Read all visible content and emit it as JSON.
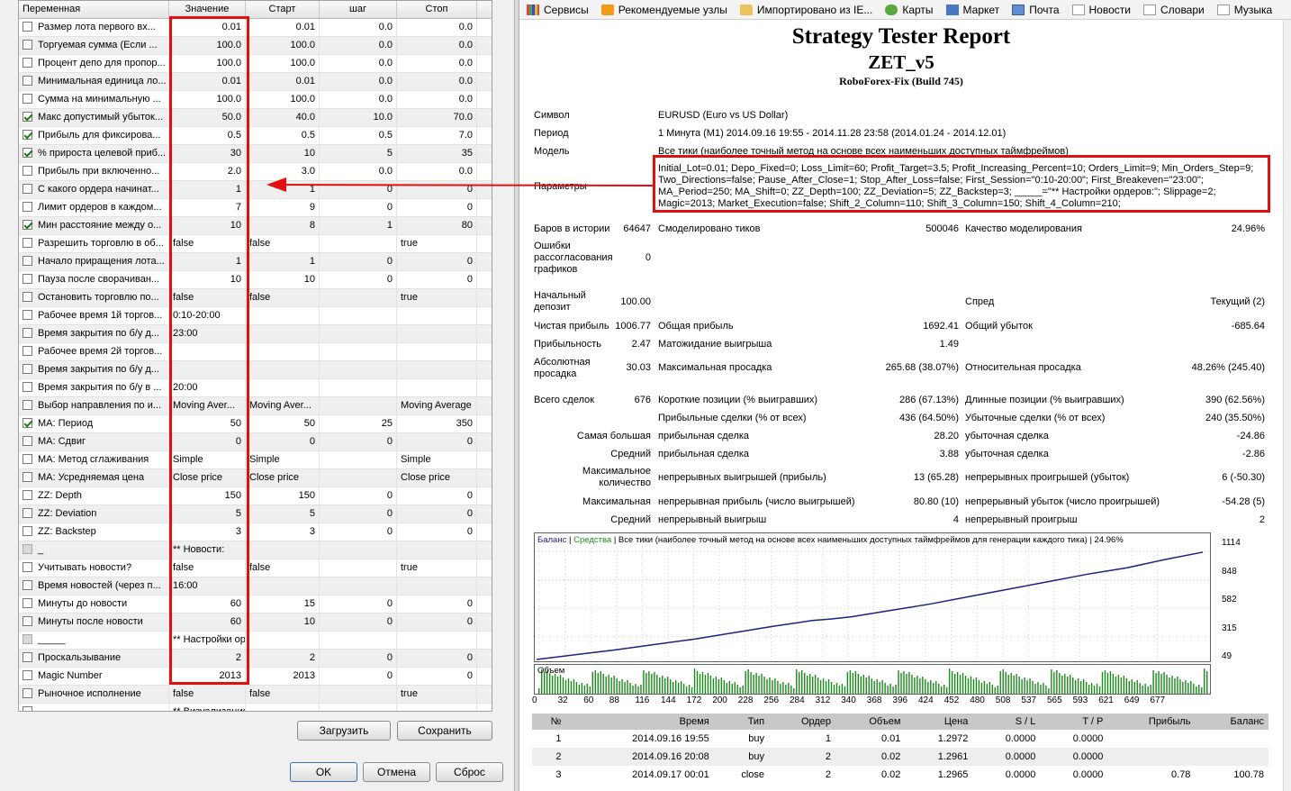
{
  "grid": {
    "headers": [
      "Переменная",
      "Значение",
      "Старт",
      "шаг",
      "Стоп"
    ],
    "rows": [
      {
        "checked": false,
        "name": "Размер лота первого вх...",
        "value": "0.01",
        "start": "0.01",
        "step": "0.0",
        "stop": "0.0",
        "type": "num"
      },
      {
        "checked": false,
        "name": "Торгуемая сумма (Если ...",
        "value": "100.0",
        "start": "100.0",
        "step": "0.0",
        "stop": "0.0",
        "type": "num"
      },
      {
        "checked": false,
        "name": "Процент депо для пропор...",
        "value": "100.0",
        "start": "100.0",
        "step": "0.0",
        "stop": "0.0",
        "type": "num"
      },
      {
        "checked": false,
        "name": "Минимальная единица ло...",
        "value": "0.01",
        "start": "0.01",
        "step": "0.0",
        "stop": "0.0",
        "type": "num"
      },
      {
        "checked": false,
        "name": "Сумма на минимальную ...",
        "value": "100.0",
        "start": "100.0",
        "step": "0.0",
        "stop": "0.0",
        "type": "num"
      },
      {
        "checked": true,
        "name": "Макс допустимый убыток...",
        "value": "50.0",
        "start": "40.0",
        "step": "10.0",
        "stop": "70.0",
        "type": "num"
      },
      {
        "checked": true,
        "name": "Прибыль для фиксирова...",
        "value": "0.5",
        "start": "0.5",
        "step": "0.5",
        "stop": "7.0",
        "type": "num"
      },
      {
        "checked": true,
        "name": "% прироста целевой приб...",
        "value": "30",
        "start": "10",
        "step": "5",
        "stop": "35",
        "type": "num"
      },
      {
        "checked": false,
        "name": "Прибыль при включенно...",
        "value": "2.0",
        "start": "3.0",
        "step": "0.0",
        "stop": "0.0",
        "type": "num"
      },
      {
        "checked": false,
        "name": "С какого ордера начинат...",
        "value": "1",
        "start": "1",
        "step": "0",
        "stop": "0",
        "type": "num"
      },
      {
        "checked": false,
        "name": "Лимит ордеров в каждом...",
        "value": "7",
        "start": "9",
        "step": "0",
        "stop": "0",
        "type": "num"
      },
      {
        "checked": true,
        "name": "Мин расстояние между о...",
        "value": "10",
        "start": "8",
        "step": "1",
        "stop": "80",
        "type": "num"
      },
      {
        "checked": false,
        "name": "Разрешить торговлю в об...",
        "value": "false",
        "start": "false",
        "step": "",
        "stop": "true",
        "type": "txt"
      },
      {
        "checked": false,
        "name": "Начало приращения лота...",
        "value": "1",
        "start": "1",
        "step": "0",
        "stop": "0",
        "type": "num"
      },
      {
        "checked": false,
        "name": "Пауза после сворачиван...",
        "value": "10",
        "start": "10",
        "step": "0",
        "stop": "0",
        "type": "num"
      },
      {
        "checked": false,
        "name": "Остановить торговлю по...",
        "value": "false",
        "start": "false",
        "step": "",
        "stop": "true",
        "type": "txt"
      },
      {
        "checked": false,
        "name": "Рабочее время 1й торгов...",
        "value": "0:10-20:00",
        "start": "",
        "step": "",
        "stop": "",
        "type": "txt"
      },
      {
        "checked": false,
        "name": "Время закрытия по б/у д...",
        "value": "23:00",
        "start": "",
        "step": "",
        "stop": "",
        "type": "txt"
      },
      {
        "checked": false,
        "name": "Рабочее время 2й торгов...",
        "value": "",
        "start": "",
        "step": "",
        "stop": "",
        "type": "txt"
      },
      {
        "checked": false,
        "name": "Время закрытия по б/у д...",
        "value": "",
        "start": "",
        "step": "",
        "stop": "",
        "type": "txt"
      },
      {
        "checked": false,
        "name": "Время закрытия по б/у в ...",
        "value": "20:00",
        "start": "",
        "step": "",
        "stop": "",
        "type": "txt"
      },
      {
        "checked": false,
        "name": "Выбор направления по и...",
        "value": "Moving Aver...",
        "start": "Moving Aver...",
        "step": "",
        "stop": "Moving Average",
        "type": "txt"
      },
      {
        "checked": true,
        "name": "MA: Период",
        "value": "50",
        "start": "50",
        "step": "25",
        "stop": "350",
        "type": "num"
      },
      {
        "checked": false,
        "name": "MA: Сдвиг",
        "value": "0",
        "start": "0",
        "step": "0",
        "stop": "0",
        "type": "num"
      },
      {
        "checked": false,
        "name": "MA: Метод сглаживания",
        "value": "Simple",
        "start": "Simple",
        "step": "",
        "stop": "Simple",
        "type": "txt"
      },
      {
        "checked": false,
        "name": "MA: Усредняемая цена",
        "value": "Close price",
        "start": "Close price",
        "step": "",
        "stop": "Close price",
        "type": "txt"
      },
      {
        "checked": false,
        "name": "ZZ: Depth",
        "value": "150",
        "start": "150",
        "step": "0",
        "stop": "0",
        "type": "num"
      },
      {
        "checked": false,
        "name": "ZZ: Deviation",
        "value": "5",
        "start": "5",
        "step": "0",
        "stop": "0",
        "type": "num"
      },
      {
        "checked": false,
        "name": "ZZ: Backstep",
        "value": "3",
        "start": "3",
        "step": "0",
        "stop": "0",
        "type": "num"
      },
      {
        "checked": false,
        "disabled": true,
        "name": "_",
        "value": "** Новости:",
        "start": "",
        "step": "",
        "stop": "",
        "type": "txt"
      },
      {
        "checked": false,
        "name": "Учитывать новости?",
        "value": "false",
        "start": "false",
        "step": "",
        "stop": "true",
        "type": "txt"
      },
      {
        "checked": false,
        "name": "Время новостей (через п...",
        "value": "16:00",
        "start": "",
        "step": "",
        "stop": "",
        "type": "txt"
      },
      {
        "checked": false,
        "name": "Минуты до новости",
        "value": "60",
        "start": "15",
        "step": "0",
        "stop": "0",
        "type": "num"
      },
      {
        "checked": false,
        "name": "Минуты после новости",
        "value": "60",
        "start": "10",
        "step": "0",
        "stop": "0",
        "type": "num"
      },
      {
        "checked": false,
        "disabled": true,
        "name": "_____",
        "value": "** Настройки ордеров:",
        "start": "",
        "step": "",
        "stop": "",
        "type": "txt"
      },
      {
        "checked": false,
        "name": "Проскальзывание",
        "value": "2",
        "start": "2",
        "step": "0",
        "stop": "0",
        "type": "num"
      },
      {
        "checked": false,
        "name": "Magic Number",
        "value": "2013",
        "start": "2013",
        "step": "0",
        "stop": "0",
        "type": "num"
      },
      {
        "checked": false,
        "name": "Рыночное исполнение",
        "value": "false",
        "start": "false",
        "step": "",
        "stop": "true",
        "type": "txt"
      },
      {
        "checked": false,
        "name": "",
        "value": "** Визуализация:",
        "start": "",
        "step": "",
        "stop": "",
        "type": "txt"
      }
    ]
  },
  "buttons": {
    "load": "Загрузить",
    "save": "Сохранить",
    "ok": "OK",
    "cancel": "Отмена",
    "reset": "Сброс"
  },
  "bookmarks": [
    {
      "label": "Сервисы",
      "icon": "apps-grid-icon",
      "cls": "ico-grid"
    },
    {
      "label": "Рекомендуемые узлы",
      "icon": "recommended-sites-icon",
      "cls": "ico-orange"
    },
    {
      "label": "Импортировано из IE...",
      "icon": "folder-icon",
      "cls": "ico-folder"
    },
    {
      "label": "Карты",
      "icon": "maps-icon",
      "cls": "ico-green"
    },
    {
      "label": "Маркет",
      "icon": "market-icon",
      "cls": "ico-blue"
    },
    {
      "label": "Почта",
      "icon": "mail-icon",
      "cls": "ico-mail"
    },
    {
      "label": "Новости",
      "icon": "page-icon",
      "cls": "ico-doc"
    },
    {
      "label": "Словари",
      "icon": "page-icon",
      "cls": "ico-doc"
    },
    {
      "label": "Музыка",
      "icon": "page-icon",
      "cls": "ico-doc"
    }
  ],
  "report": {
    "title": "Strategy Tester Report",
    "ea": "ZET_v5",
    "server": "RoboForex-Fix (Build 745)",
    "symbol_label": "Символ",
    "symbol": "EURUSD (Euro vs US Dollar)",
    "period_label": "Период",
    "period": "1 Минута (M1) 2014.09.16 19:55 - 2014.11.28 23:58 (2014.01.24 - 2014.12.01)",
    "model_label": "Модель",
    "model": "Все тики (наиболее точный метод на основе всех наименьших доступных таймфреймов)",
    "params_label": "Параметры",
    "params_l1": "Initial_Lot=0.01; Depo_Fixed=0; Loss_Limit=60; Profit_Target=3.5; Profit_Increasing_Percent=10; Orders_Limit=9; Min_Orders_Step=9;",
    "params_l2": "Two_Directions=false; Pause_After_Close=1; Stop_After_Loss=false; First_Session=\"0:10-20:00\"; First_Breakeven=\"23:00\";",
    "params_l3": "MA_Period=250; MA_Shift=0; ZZ_Depth=100; ZZ_Deviation=5; ZZ_Backstep=3; _____=\"** Настройки ордеров:\"; Slippage=2;",
    "params_l4": "Magic=2013; Market_Execution=false; Shift_2_Column=110; Shift_3_Column=150; Shift_4_Column=210;",
    "bars_label": "Баров в истории",
    "bars": "64647",
    "ticks_label": "Смоделировано тиков",
    "ticks": "500046",
    "quality_label": "Качество моделирования",
    "quality": "24.96%",
    "errors_l1": "Ошибки",
    "errors_l2": "рассогласования",
    "errors_l3": "графиков",
    "errors": "0",
    "deposit_l1": "Начальный",
    "deposit_l2": "депозит",
    "deposit": "100.00",
    "spread_label": "Спред",
    "spread": "Текущий (2)",
    "net_label": "Чистая прибыль",
    "net": "1006.77",
    "gross_profit_label": "Общая прибыль",
    "gross_profit": "1692.41",
    "gross_loss_label": "Общий убыток",
    "gross_loss": "-685.64",
    "pf_label": "Прибыльность",
    "pf": "2.47",
    "exp_label": "Матожидание выигрыша",
    "exp": "1.49",
    "absdd_l1": "Абсолютная",
    "absdd_l2": "просадка",
    "absdd": "30.03",
    "maxdd_label": "Максимальная просадка",
    "maxdd": "265.68 (38.07%)",
    "reldd_label": "Относительная просадка",
    "reldd": "48.26% (245.40)",
    "trades_label": "Всего сделок",
    "trades": "676",
    "short_label": "Короткие позиции (% выигравших)",
    "short": "286 (67.13%)",
    "long_label": "Длинные позиции (% выигравших)",
    "long": "390 (62.56%)",
    "profit_trades_label": "Прибыльные сделки (% от всех)",
    "profit_trades": "436 (64.50%)",
    "loss_trades_label": "Убыточные сделки (% от всех)",
    "loss_trades": "240 (35.50%)",
    "largest_label": "Самая большая",
    "largest_profit_label": "прибыльная сделка",
    "largest_profit": "28.20",
    "largest_loss_label": "убыточная сделка",
    "largest_loss": "-24.86",
    "avg_label": "Средний",
    "avg_profit_label": "прибыльная сделка",
    "avg_profit": "3.88",
    "avg_loss_label": "убыточная сделка",
    "avg_loss": "-2.86",
    "maxcount_l1": "Максимальное",
    "maxcount_l2": "количество",
    "consec_wins_label": "непрерывных выигрышей (прибыль)",
    "consec_wins": "13 (65.28)",
    "consec_losses_label": "непрерывных проигрышей (убыток)",
    "consec_losses": "6 (-50.30)",
    "maximal_label": "Максимальная",
    "consec_profit_label": "непрерывная прибыль (число выигрышей)",
    "consec_profit": "80.80 (10)",
    "consec_loss_label": "непрерывный убыток (число проигрышей)",
    "consec_loss": "-54.28 (5)",
    "average_label": "Средний",
    "avg_wins_label": "непрерывный выигрыш",
    "avg_wins": "4",
    "avg_losses_label": "непрерывный проигрыш",
    "avg_losses": "2"
  },
  "chart_data": {
    "type": "line",
    "legend_balance": "Баланс",
    "legend_equity": "Средства",
    "legend_rest": "| Все тики (наиболее точный метод на основе всех наименьших доступных таймфреймов для генерации каждого тика) | 24.96%",
    "volume_label": "Объем",
    "ylim": [
      49,
      1114
    ],
    "yticks": [
      "1114",
      "848",
      "582",
      "315",
      "49"
    ],
    "xticks": [
      "0",
      "32",
      "60",
      "88",
      "116",
      "144",
      "172",
      "200",
      "228",
      "256",
      "284",
      "312",
      "340",
      "368",
      "396",
      "424",
      "452",
      "480",
      "508",
      "537",
      "565",
      "593",
      "621",
      "649",
      "677"
    ],
    "x": [
      0,
      40,
      80,
      120,
      160,
      200,
      240,
      280,
      300,
      320,
      360,
      400,
      440,
      480,
      520,
      560,
      600,
      640,
      677
    ],
    "balance": [
      100,
      145,
      190,
      240,
      290,
      350,
      410,
      465,
      480,
      500,
      560,
      620,
      690,
      760,
      830,
      900,
      960,
      1040,
      1106
    ],
    "balance_color": "#1a237e",
    "equity_color": "#1b8a1b"
  },
  "trades": {
    "headers": [
      "№",
      "Время",
      "Тип",
      "Ордер",
      "Объем",
      "Цена",
      "S / L",
      "T / P",
      "Прибыль",
      "Баланс"
    ],
    "rows": [
      [
        "1",
        "2014.09.16 19:55",
        "buy",
        "1",
        "0.01",
        "1.2972",
        "0.0000",
        "0.0000",
        "",
        ""
      ],
      [
        "2",
        "2014.09.16 20:08",
        "buy",
        "2",
        "0.02",
        "1.2961",
        "0.0000",
        "0.0000",
        "",
        ""
      ],
      [
        "3",
        "2014.09.17 00:01",
        "close",
        "2",
        "0.02",
        "1.2965",
        "0.0000",
        "0.0000",
        "0.78",
        "100.78"
      ]
    ]
  }
}
